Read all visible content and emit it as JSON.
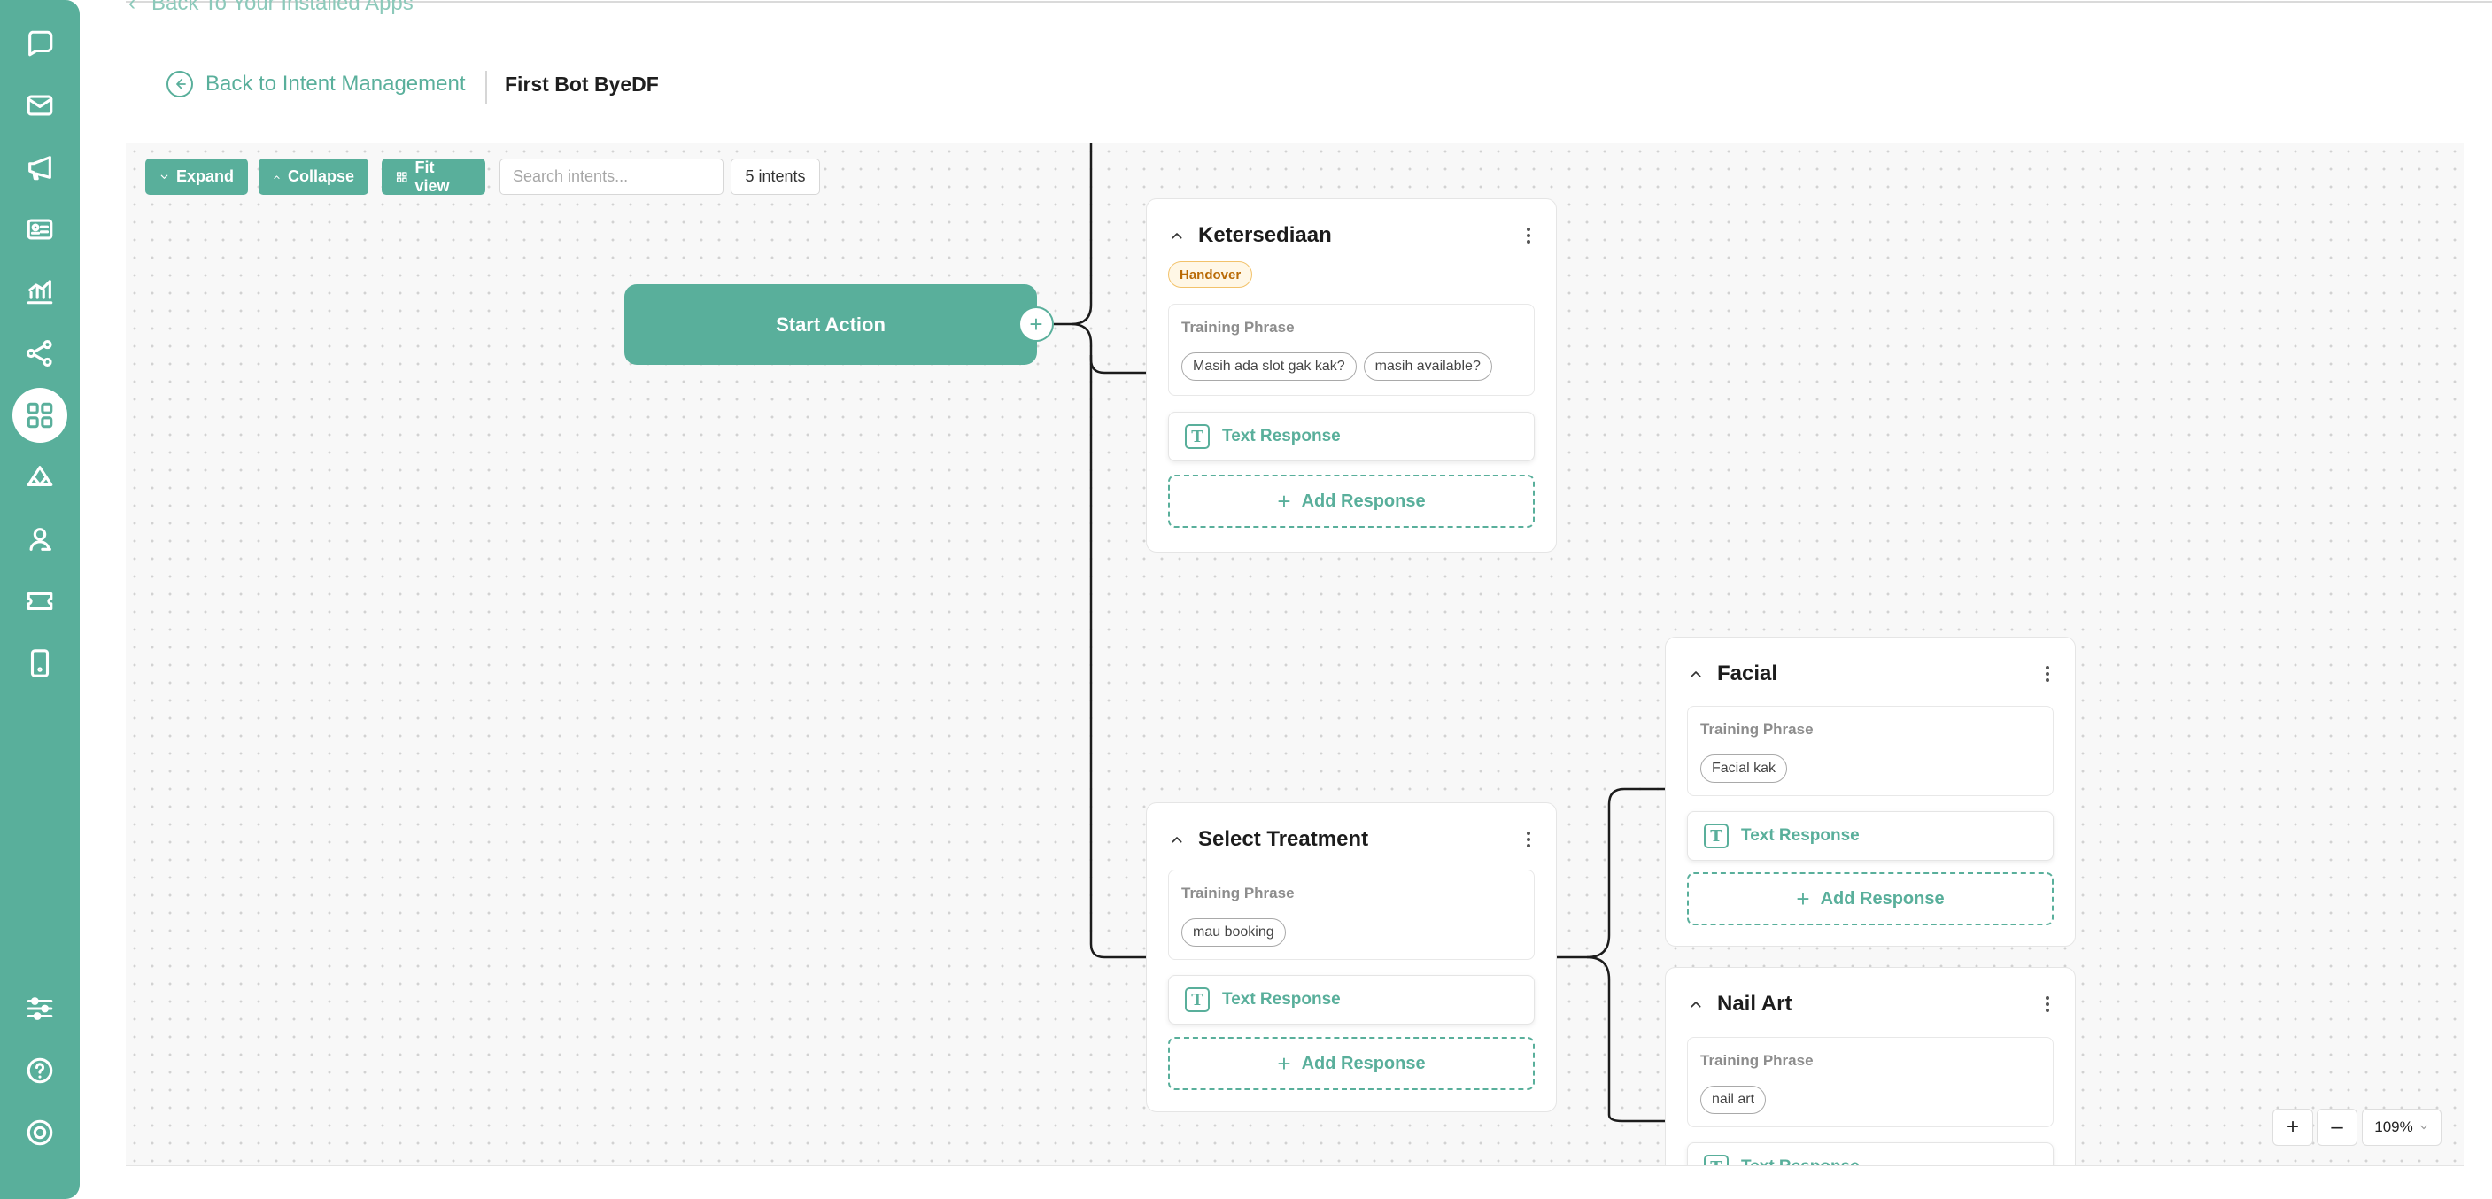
{
  "top_link": {
    "label": "Back To Your Installed Apps"
  },
  "header": {
    "back_label": "Back to Intent Management",
    "bot_name": "First Bot ByeDF"
  },
  "toolbar": {
    "expand_label": "Expand",
    "collapse_label": "Collapse",
    "fit_label": "Fit view",
    "search_placeholder": "Search intents...",
    "intent_count": "5 intents"
  },
  "flow": {
    "start_label": "Start Action",
    "plus": "+"
  },
  "intents": {
    "ketersediaan": {
      "title": "Ketersediaan",
      "badge": "Handover",
      "phrase_label": "Training Phrase",
      "phrases": [
        "Masih ada slot gak kak?",
        "masih available?"
      ],
      "response_label": "Text Response",
      "add_label": "Add Response"
    },
    "select_treatment": {
      "title": "Select Treatment",
      "phrase_label": "Training Phrase",
      "phrases": [
        "mau booking"
      ],
      "response_label": "Text Response",
      "add_label": "Add Response"
    },
    "facial": {
      "title": "Facial",
      "phrase_label": "Training Phrase",
      "phrases": [
        "Facial kak"
      ],
      "response_label": "Text Response",
      "add_label": "Add Response"
    },
    "nail_art": {
      "title": "Nail Art",
      "phrase_label": "Training Phrase",
      "phrases": [
        "nail art"
      ],
      "response_label": "Text Response"
    }
  },
  "zoom": {
    "plus": "+",
    "minus": "–",
    "level": "109%"
  },
  "colors": {
    "accent": "#59af9b",
    "badge_border": "#f2c26b",
    "badge_text": "#b96a06"
  },
  "icons": {
    "sidebar": [
      "chat-icon",
      "mail-icon",
      "megaphone-icon",
      "contact-card-icon",
      "analytics-icon",
      "share-nodes-icon",
      "apps-grid-icon",
      "broadcast-icon",
      "agent-icon",
      "ticket-icon",
      "mobile-icon",
      "settings-sliders-icon",
      "help-icon",
      "power-icon"
    ]
  }
}
